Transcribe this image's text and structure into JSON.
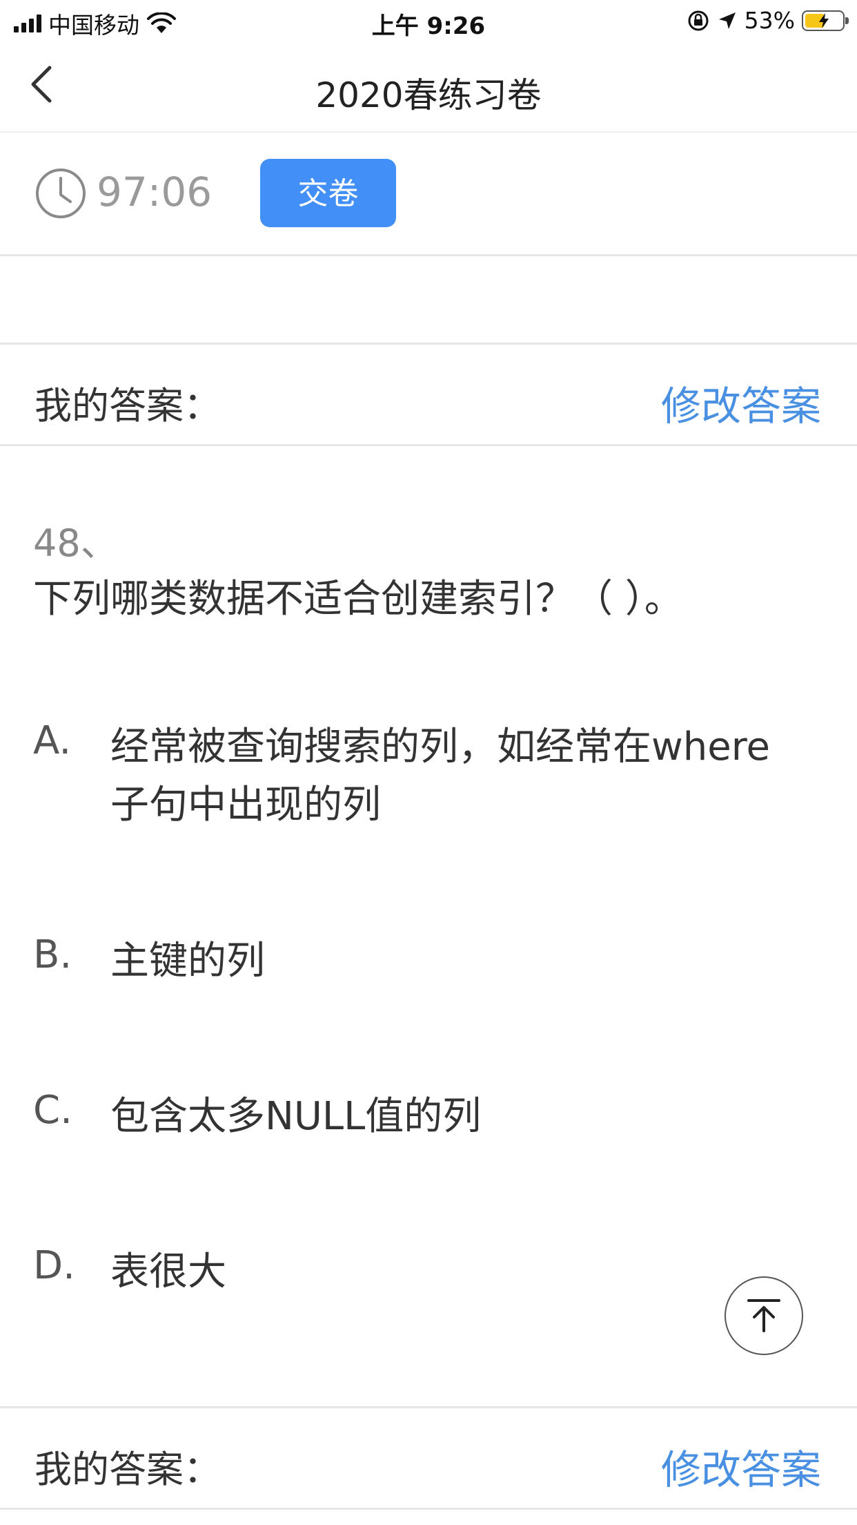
{
  "status_bar": {
    "carrier": "中国移动",
    "time": "上午 9:26",
    "battery": "53%",
    "battery_level": 0.53
  },
  "nav": {
    "title": "2020春练习卷"
  },
  "timer": {
    "remaining": "97:06",
    "submit_label": "交卷"
  },
  "answer_bar": {
    "label": "我的答案：",
    "modify_label": "修改答案"
  },
  "question": {
    "number": "48、",
    "text": "下列哪类数据不适合创建索引？（ ）。",
    "options": [
      {
        "letter": "A.",
        "text": "经常被查询搜索的列，如经常在where子句中出现的列"
      },
      {
        "letter": "B.",
        "text": "主键的列"
      },
      {
        "letter": "C.",
        "text": "包含太多NULL值的列"
      },
      {
        "letter": "D.",
        "text": "表很大"
      }
    ]
  },
  "colors": {
    "accent": "#4290f7",
    "link": "#4a90e2"
  },
  "icons": {
    "back": "chevron-left-icon",
    "clock": "clock-icon",
    "top": "back-to-top-icon"
  }
}
